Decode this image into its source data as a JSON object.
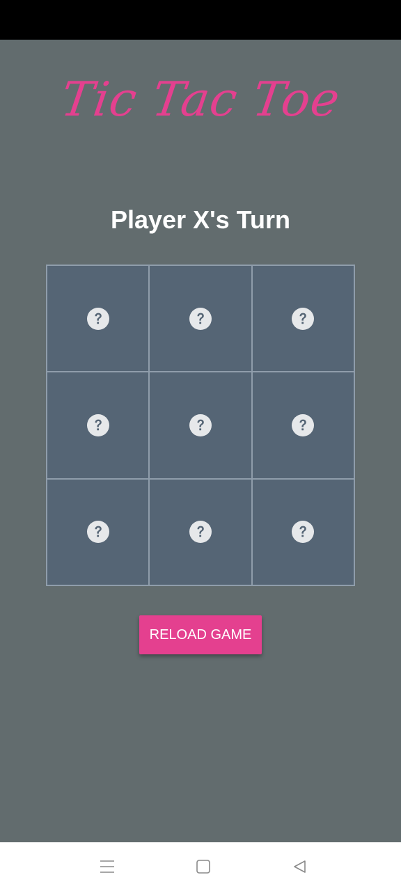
{
  "app": {
    "title": "Tic Tac Toe",
    "accent_color": "#e4408f",
    "background_color": "#626c6e",
    "cell_color": "#556575"
  },
  "game": {
    "turn_text": "Player X's Turn",
    "board": [
      {
        "state": "empty",
        "icon": "question-circle-icon"
      },
      {
        "state": "empty",
        "icon": "question-circle-icon"
      },
      {
        "state": "empty",
        "icon": "question-circle-icon"
      },
      {
        "state": "empty",
        "icon": "question-circle-icon"
      },
      {
        "state": "empty",
        "icon": "question-circle-icon"
      },
      {
        "state": "empty",
        "icon": "question-circle-icon"
      },
      {
        "state": "empty",
        "icon": "question-circle-icon"
      },
      {
        "state": "empty",
        "icon": "question-circle-icon"
      },
      {
        "state": "empty",
        "icon": "question-circle-icon"
      }
    ],
    "reload_label": "RELOAD GAME"
  },
  "system_nav": {
    "menu_icon": "menu-lines-icon",
    "home_icon": "square-home-icon",
    "back_icon": "triangle-back-icon"
  }
}
